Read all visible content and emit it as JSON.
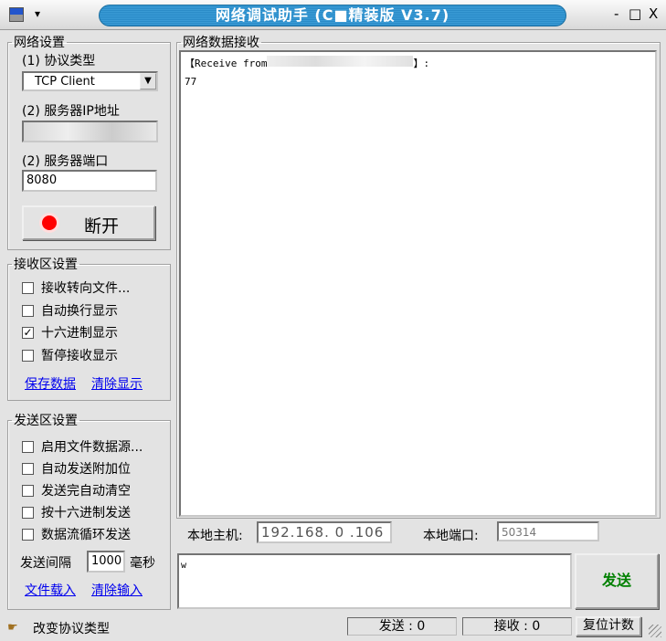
{
  "window": {
    "title": "网络调试助手 (C■精装版 V3.7)",
    "minimize": "-",
    "maximize": "□",
    "close": "X",
    "menu_arrow": "▾"
  },
  "network": {
    "legend": "网络设置",
    "protocol_label": "(1) 协议类型",
    "protocol_value": "TCP Client",
    "ip_label": "(2) 服务器IP地址",
    "ip_value": "",
    "port_label": "(2) 服务器端口",
    "port_value": "8080",
    "disconnect_label": "断开",
    "status_color": "#ff0000"
  },
  "receive_settings": {
    "legend": "接收区设置",
    "options": [
      {
        "label": "接收转向文件...",
        "checked": false
      },
      {
        "label": "自动换行显示",
        "checked": false
      },
      {
        "label": "十六进制显示",
        "checked": true
      },
      {
        "label": "暂停接收显示",
        "checked": false
      }
    ],
    "save_link": "保存数据",
    "clear_link": "清除显示"
  },
  "send_settings": {
    "legend": "发送区设置",
    "options": [
      {
        "label": "启用文件数据源...",
        "checked": false
      },
      {
        "label": "自动发送附加位",
        "checked": false
      },
      {
        "label": "发送完自动清空",
        "checked": false
      },
      {
        "label": "按十六进制发送",
        "checked": false
      },
      {
        "label": "数据流循环发送",
        "checked": false
      }
    ],
    "interval_label": "发送间隔",
    "interval_value": "1000",
    "interval_unit": "毫秒",
    "load_link": "文件载入",
    "clear_link": "清除输入"
  },
  "receive": {
    "legend": "网络数据接收",
    "header": "【Receive from",
    "header_end": "】:",
    "data": "77"
  },
  "local": {
    "host_label": "本地主机:",
    "ip": [
      "192",
      "168",
      "0",
      "106"
    ],
    "port_label": "本地端口:",
    "port": "50314"
  },
  "send": {
    "input": "w",
    "button": "发送"
  },
  "statusbar": {
    "hint": "改变协议类型",
    "sent": "发送 : 0",
    "received": "接收 : 0",
    "reset": "复位计数"
  }
}
